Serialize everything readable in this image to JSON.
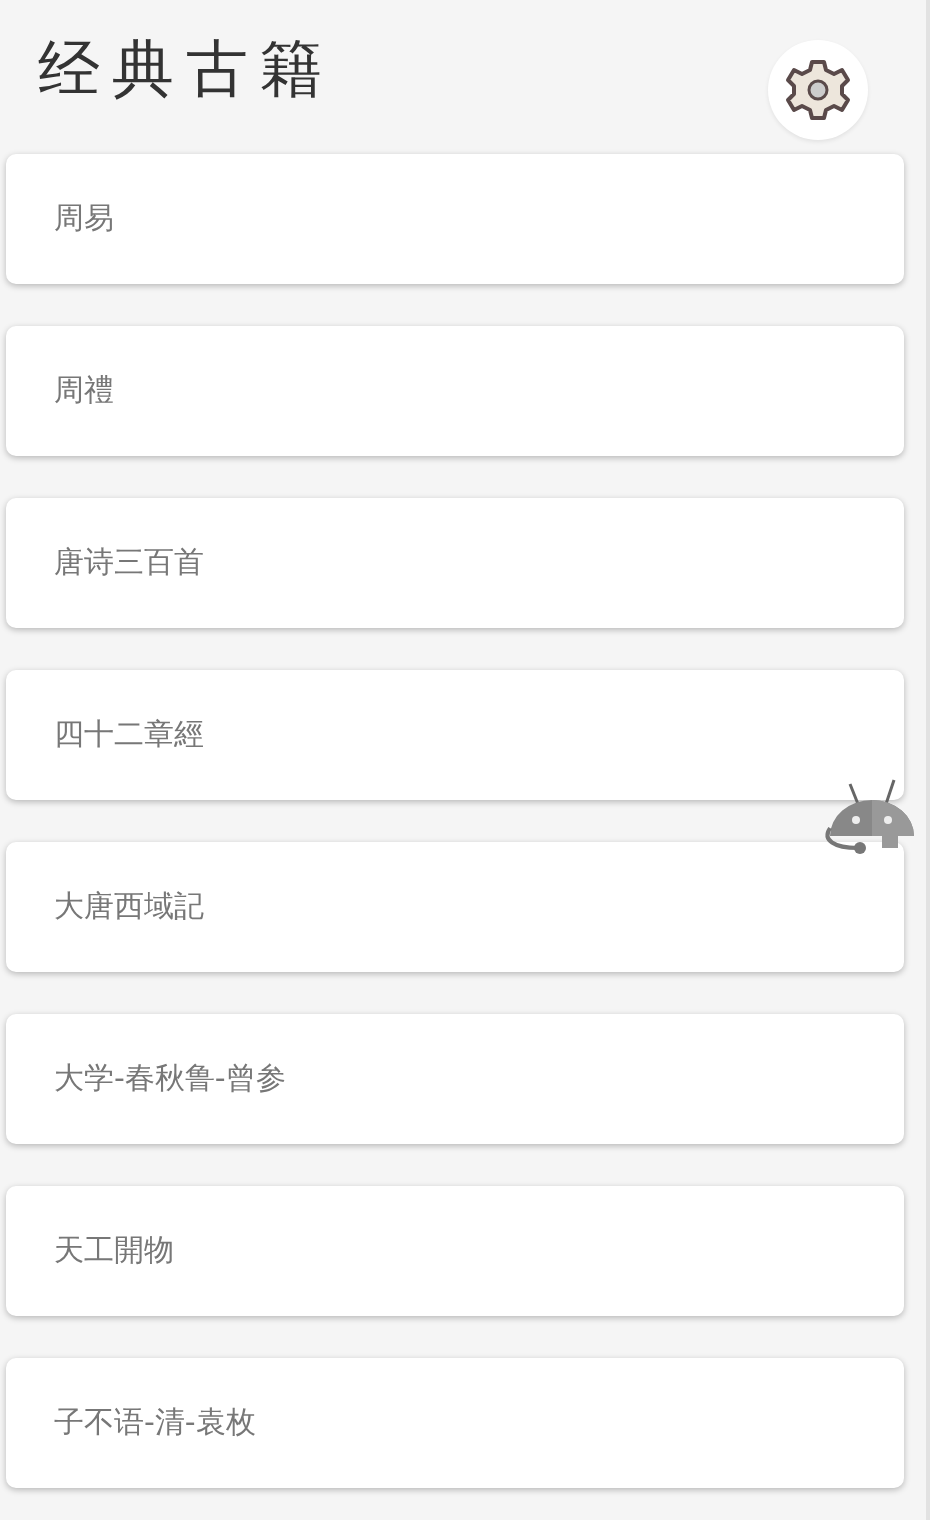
{
  "header": {
    "title": "经典古籍"
  },
  "books": [
    {
      "title": "周易"
    },
    {
      "title": "周禮"
    },
    {
      "title": "唐诗三百首"
    },
    {
      "title": "四十二章經"
    },
    {
      "title": "大唐西域記"
    },
    {
      "title": "大学-春秋鲁-曾参"
    },
    {
      "title": "天工開物"
    },
    {
      "title": "子不语-清-袁枚"
    }
  ]
}
